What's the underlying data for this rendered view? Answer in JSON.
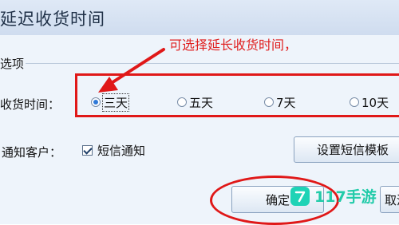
{
  "window": {
    "title": "延迟收货时间"
  },
  "annotation": {
    "text": "可选择延长收货时间，",
    "color": "#e02020"
  },
  "options_group": {
    "label": "选项"
  },
  "delivery_time": {
    "label": "收货时间：",
    "options": [
      {
        "label": "三天",
        "selected": true
      },
      {
        "label": "五天",
        "selected": false
      },
      {
        "label": "7天",
        "selected": false
      },
      {
        "label": "10天",
        "selected": false
      }
    ]
  },
  "notify": {
    "label": "通知客户：",
    "sms_label": "短信通知",
    "sms_checked": true
  },
  "buttons": {
    "sms_template": "设置短信模板",
    "ok": "确定",
    "cancel": "取消"
  },
  "watermark": {
    "text": "117手游"
  }
}
